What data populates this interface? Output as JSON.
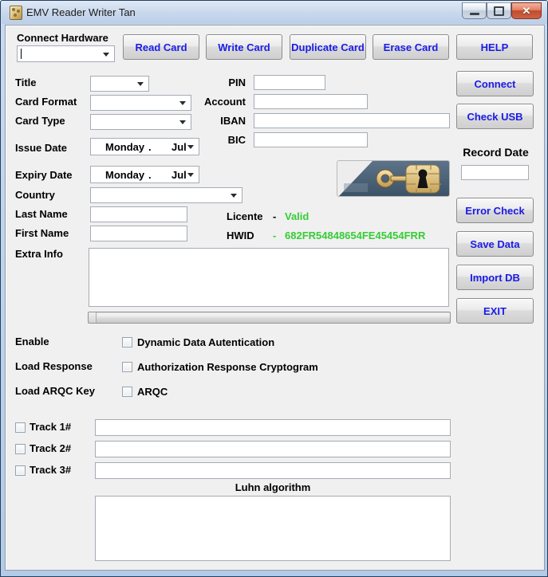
{
  "titlebar": {
    "title": "EMV Reader Writer Tan"
  },
  "icons": {
    "close_glyph": "✕"
  },
  "colors": {
    "button_text": "#1B1BE8",
    "valid_green": "#35CD35"
  },
  "toolbar": {
    "connect_hardware_label": "Connect Hardware",
    "read_card": "Read Card",
    "write_card": "Write Card",
    "duplicate_card": "Duplicate Card",
    "erase_card": "Erase Card",
    "help": "HELP"
  },
  "side_buttons": {
    "connect": "Connect",
    "check_usb": "Check USB",
    "error_check": "Error Check",
    "save_data": "Save Data",
    "import_db": "Import DB",
    "exit": "EXIT"
  },
  "form": {
    "title_label": "Title",
    "card_format_label": "Card Format",
    "card_type_label": "Card Type",
    "issue_date_label": "Issue Date",
    "expiry_date_label": "Expiry Date",
    "country_label": "Country",
    "last_name_label": "Last Name",
    "first_name_label": "First Name",
    "extra_info_label": "Extra Info",
    "pin_label": "PIN",
    "account_label": "Account",
    "iban_label": "IBAN",
    "bic_label": "BIC",
    "record_date_label": "Record Date"
  },
  "date_picker": {
    "day": "Monday",
    "separator": ".",
    "month": "Jul"
  },
  "license": {
    "licente_label": "Licente",
    "licente_dash": "-",
    "licente_value": "Valid",
    "hwid_label": "HWID",
    "hwid_dash": "-",
    "hwid_value": "682FR54848654FE45454FRR"
  },
  "options": {
    "enable_label": "Enable",
    "dda_option": "Dynamic Data Autentication",
    "load_response_label": "Load Response",
    "arc_option": "Authorization Response Cryptogram",
    "load_arqc_label": "Load ARQC Key",
    "arqc_option": "ARQC"
  },
  "tracks": [
    {
      "label": "Track 1#"
    },
    {
      "label": "Track 2#"
    },
    {
      "label": "Track 3#"
    }
  ],
  "luhn": {
    "label": "Luhn algorithm"
  },
  "values": {
    "connect_hardware": "",
    "title": "",
    "card_format": "",
    "card_type": "",
    "country": "",
    "pin": "",
    "account": "",
    "iban": "",
    "bic": "",
    "last_name": "",
    "first_name": "",
    "extra_info": "",
    "record_date": "",
    "track1": "",
    "track2": "",
    "track3": "",
    "luhn": ""
  }
}
